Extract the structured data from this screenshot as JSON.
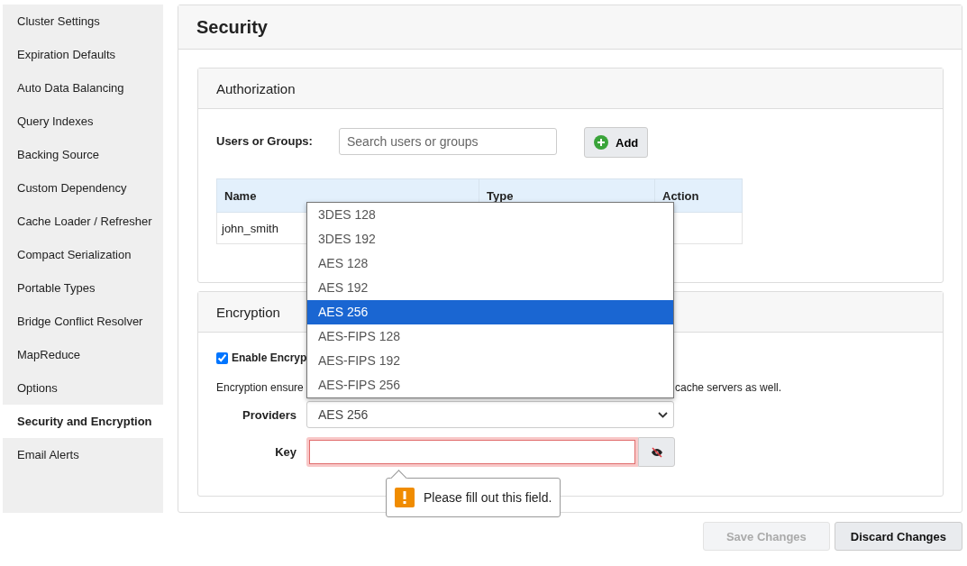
{
  "sidebar": {
    "items": [
      {
        "label": "Cluster Settings",
        "selected": false
      },
      {
        "label": "Expiration Defaults",
        "selected": false
      },
      {
        "label": "Auto Data Balancing",
        "selected": false
      },
      {
        "label": "Query Indexes",
        "selected": false
      },
      {
        "label": "Backing Source",
        "selected": false
      },
      {
        "label": "Custom Dependency",
        "selected": false
      },
      {
        "label": "Cache Loader / Refresher",
        "selected": false
      },
      {
        "label": "Compact Serialization",
        "selected": false
      },
      {
        "label": "Portable Types",
        "selected": false
      },
      {
        "label": "Bridge Conflict Resolver",
        "selected": false
      },
      {
        "label": "MapReduce",
        "selected": false
      },
      {
        "label": "Options",
        "selected": false
      },
      {
        "label": "Security and Encryption",
        "selected": true
      },
      {
        "label": "Email Alerts",
        "selected": false
      }
    ]
  },
  "page": {
    "title": "Security"
  },
  "authorization": {
    "title": "Authorization",
    "users_label": "Users or Groups:",
    "search": {
      "placeholder": "Search users or groups"
    },
    "add_button": "Add",
    "table": {
      "columns": [
        "Name",
        "Type",
        "Action"
      ],
      "rows": [
        {
          "name": "john_smith"
        }
      ]
    }
  },
  "encryption": {
    "title": "Encryption",
    "enable": {
      "label": "Enable Encryp",
      "checked": true
    },
    "description_start": "Encryption ensure",
    "description_end": "cache servers as well.",
    "providers": {
      "label": "Providers",
      "value": "AES 256",
      "expanded": true,
      "options": [
        {
          "label": "3DES 128",
          "selected": false
        },
        {
          "label": "3DES 192",
          "selected": false
        },
        {
          "label": "AES 128",
          "selected": false
        },
        {
          "label": "AES 192",
          "selected": false
        },
        {
          "label": "AES 256",
          "selected": true
        },
        {
          "label": "AES-FIPS 128",
          "selected": false
        },
        {
          "label": "AES-FIPS 192",
          "selected": false
        },
        {
          "label": "AES-FIPS 256",
          "selected": false
        }
      ]
    },
    "key": {
      "label": "Key",
      "invalid": true,
      "validation_message": "Please fill out this field."
    }
  },
  "buttons": [
    {
      "label": "Save Changes",
      "disabled": true
    },
    {
      "label": "Discard Changes",
      "disabled": false
    }
  ]
}
